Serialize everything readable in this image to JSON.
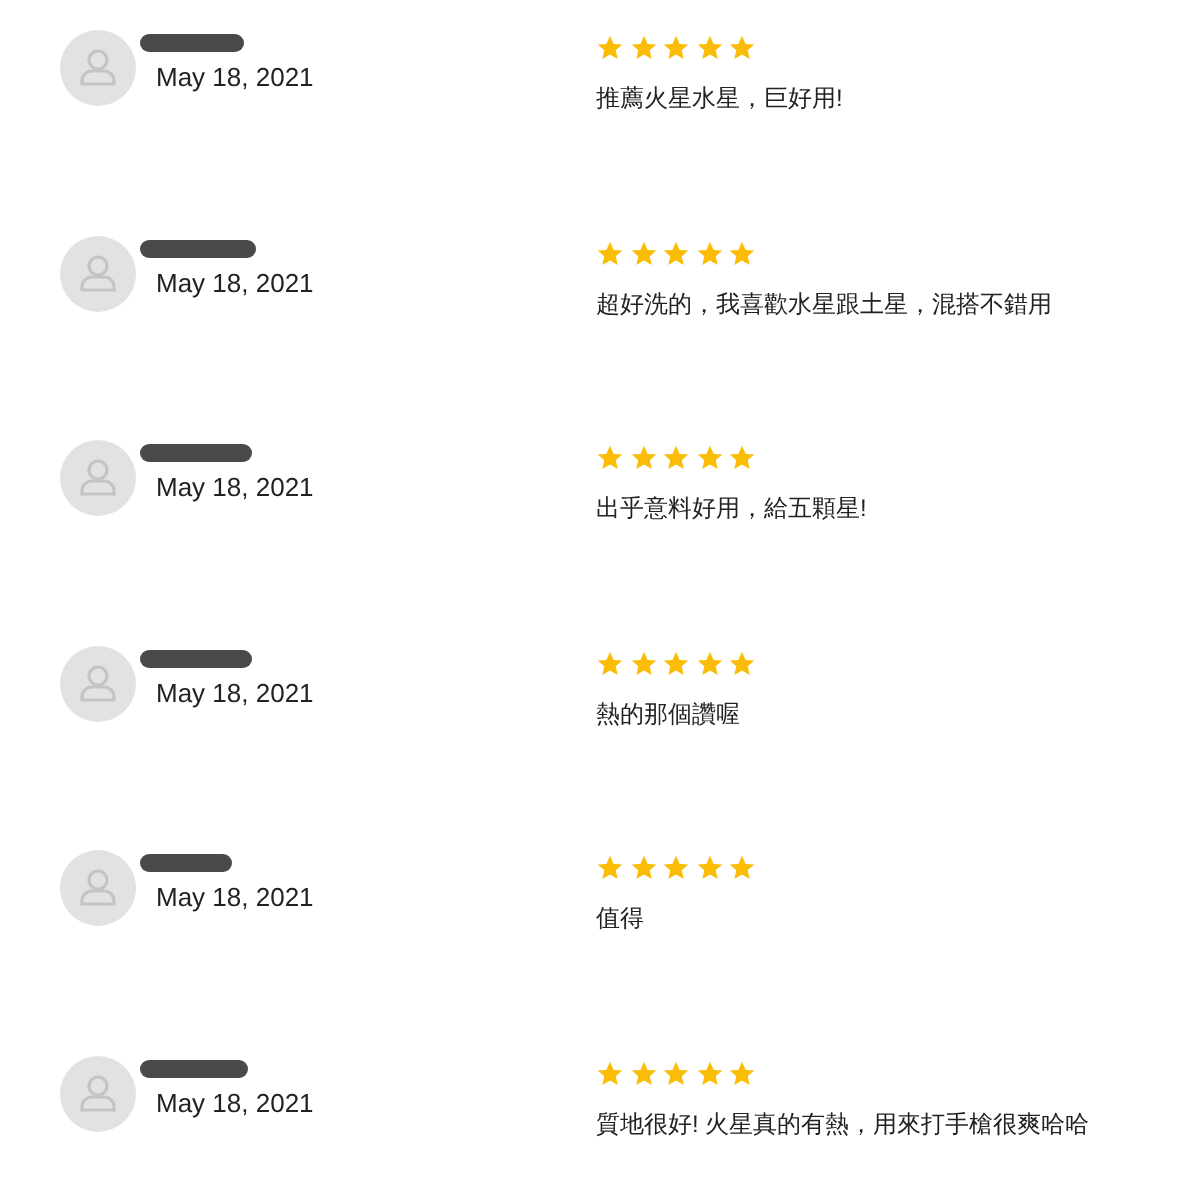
{
  "reviews": [
    {
      "date": "May 18, 2021",
      "stars": 5,
      "text": "推薦火星水星，巨好用!"
    },
    {
      "date": "May 18, 2021",
      "stars": 5,
      "text": "超好洗的，我喜歡水星跟土星，混搭不錯用"
    },
    {
      "date": "May 18, 2021",
      "stars": 5,
      "text": "出乎意料好用，給五顆星!"
    },
    {
      "date": "May 18, 2021",
      "stars": 5,
      "text": "熱的那個讚喔"
    },
    {
      "date": "May 18, 2021",
      "stars": 5,
      "text": "值得"
    },
    {
      "date": "May 18, 2021",
      "stars": 5,
      "text": "質地很好! 火星真的有熱，用來打手槍很爽哈哈"
    }
  ]
}
